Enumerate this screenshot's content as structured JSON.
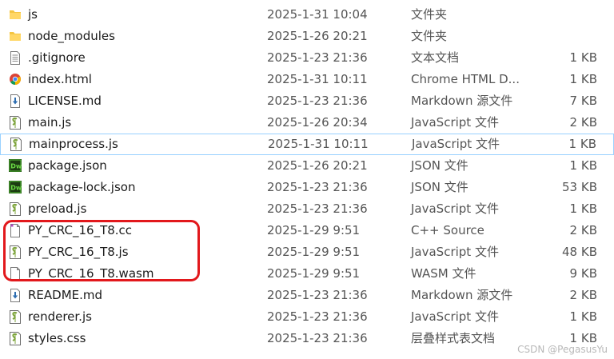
{
  "files": [
    {
      "name": "js",
      "date": "2025-1-31 10:04",
      "type": "文件夹",
      "size": "",
      "icon": "folder-icon"
    },
    {
      "name": "node_modules",
      "date": "2025-1-26 20:21",
      "type": "文件夹",
      "size": "",
      "icon": "folder-icon"
    },
    {
      "name": ".gitignore",
      "date": "2025-1-23 21:36",
      "type": "文本文档",
      "size": "1 KB",
      "icon": "text-file-icon"
    },
    {
      "name": "index.html",
      "date": "2025-1-31 10:11",
      "type": "Chrome HTML D...",
      "size": "1 KB",
      "icon": "chrome-html-icon"
    },
    {
      "name": "LICENSE.md",
      "date": "2025-1-23 21:36",
      "type": "Markdown 源文件",
      "size": "7 KB",
      "icon": "markdown-icon"
    },
    {
      "name": "main.js",
      "date": "2025-1-26 20:34",
      "type": "JavaScript 文件",
      "size": "2 KB",
      "icon": "javascript-icon"
    },
    {
      "name": "mainprocess.js",
      "date": "2025-1-31 10:11",
      "type": "JavaScript 文件",
      "size": "1 KB",
      "icon": "javascript-icon"
    },
    {
      "name": "package.json",
      "date": "2025-1-26 20:21",
      "type": "JSON 文件",
      "size": "1 KB",
      "icon": "dreamweaver-icon"
    },
    {
      "name": "package-lock.json",
      "date": "2025-1-23 21:36",
      "type": "JSON 文件",
      "size": "53 KB",
      "icon": "dreamweaver-icon"
    },
    {
      "name": "preload.js",
      "date": "2025-1-23 21:36",
      "type": "JavaScript 文件",
      "size": "1 KB",
      "icon": "javascript-icon"
    },
    {
      "name": "PY_CRC_16_T8.cc",
      "date": "2025-1-29 9:51",
      "type": "C++ Source",
      "size": "2 KB",
      "icon": "cpp-file-icon"
    },
    {
      "name": "PY_CRC_16_T8.js",
      "date": "2025-1-29 9:51",
      "type": "JavaScript 文件",
      "size": "48 KB",
      "icon": "javascript-icon"
    },
    {
      "name": "PY_CRC_16_T8.wasm",
      "date": "2025-1-29 9:51",
      "type": "WASM 文件",
      "size": "9 KB",
      "icon": "blank-file-icon"
    },
    {
      "name": "README.md",
      "date": "2025-1-23 21:36",
      "type": "Markdown 源文件",
      "size": "2 KB",
      "icon": "markdown-icon"
    },
    {
      "name": "renderer.js",
      "date": "2025-1-23 21:36",
      "type": "JavaScript 文件",
      "size": "1 KB",
      "icon": "javascript-icon"
    },
    {
      "name": "styles.css",
      "date": "2025-1-23 21:36",
      "type": "层叠样式表文档",
      "size": "1 KB",
      "icon": "css-file-icon"
    }
  ],
  "focused_row": 6,
  "highlight_color": "#e2181c",
  "watermark": "CSDN @PegasusYu"
}
